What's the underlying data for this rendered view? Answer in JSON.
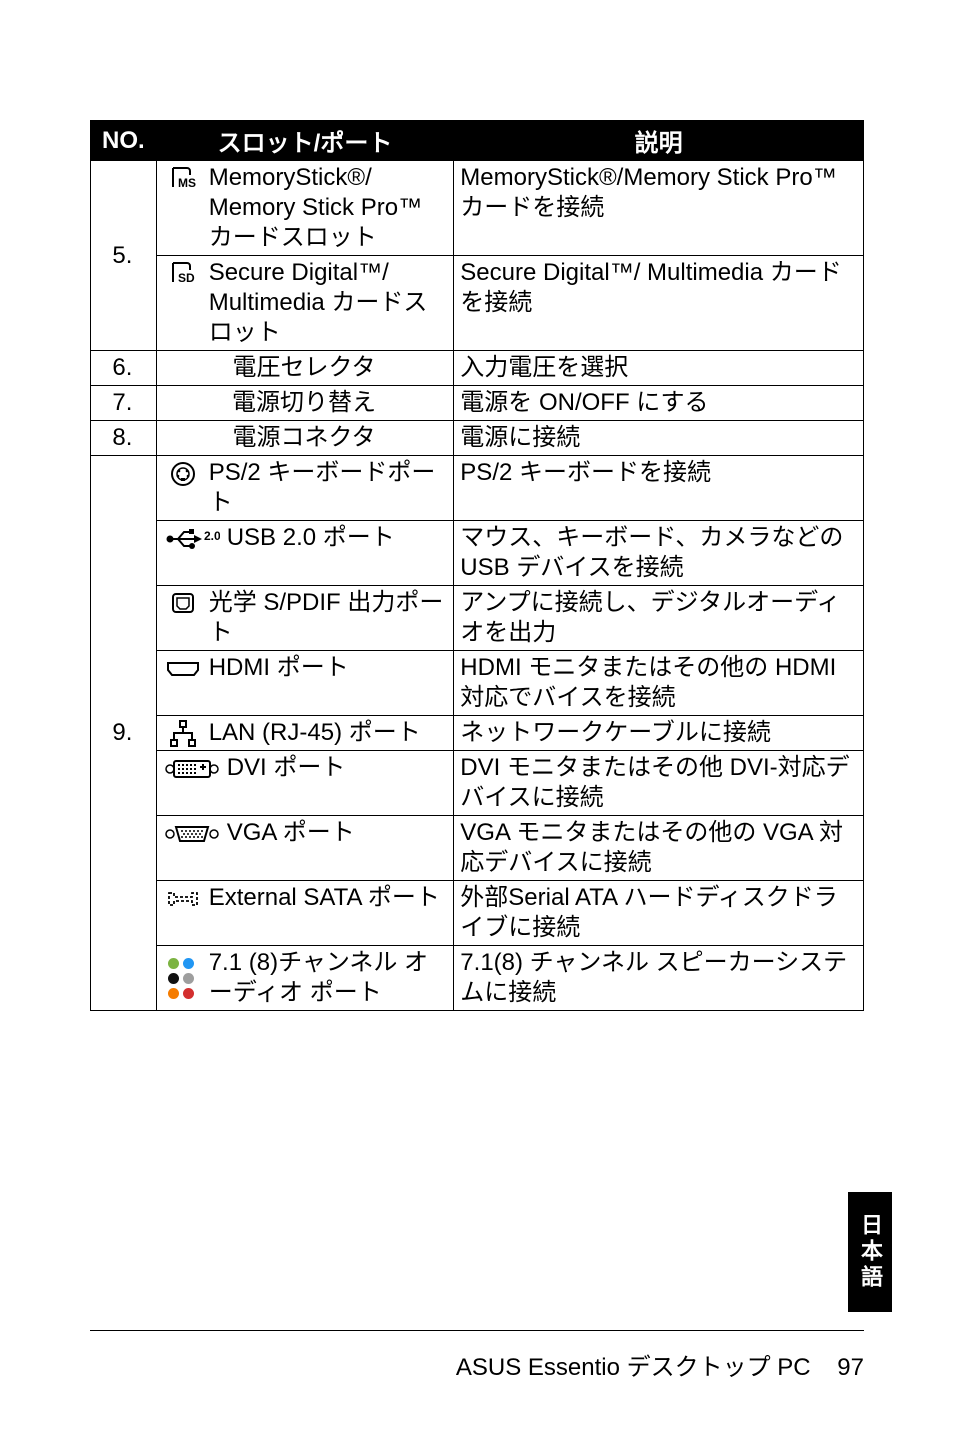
{
  "header": {
    "no": "NO.",
    "slot": "スロット/ポート",
    "desc": "説明"
  },
  "row5": {
    "no": "5.",
    "a_slot": "MemoryStick®/ Memory Stick Pro™ カードスロット",
    "a_desc": "MemoryStick®/Memory Stick Pro™ カードを接続",
    "b_slot": "Secure Digital™/ Multimedia カードスロット",
    "b_desc": "Secure Digital™/ Multimedia カードを接続"
  },
  "row6": {
    "no": "6.",
    "slot": "電圧セレクタ",
    "desc": "入力電圧を選択"
  },
  "row7": {
    "no": "7.",
    "slot": "電源切り替え",
    "desc": "電源を ON/OFF にする"
  },
  "row8": {
    "no": "8.",
    "slot": "電源コネクタ",
    "desc": "電源に接続"
  },
  "row9": {
    "no": "9.",
    "ps2_slot": "PS/2 キーボードポート",
    "ps2_desc": "PS/2 キーボードを接続",
    "usb_icon": "2.0",
    "usb_slot": "USB 2.0 ポート",
    "usb_desc": "マウス、キーボード、カメラなどの USB デバイスを接続",
    "spdif_slot": "光学 S/PDIF 出力ポート",
    "spdif_desc": "アンプに接続し、デジタルオーディオを出力",
    "hdmi_slot": "HDMI ポート",
    "hdmi_desc": "HDMI モニタまたはその他の HDMI 対応でバイスを接続",
    "lan_slot": "LAN (RJ-45) ポート",
    "lan_desc": "ネットワークケーブルに接続",
    "dvi_slot": "DVI ポート",
    "dvi_desc": "DVI モニタまたはその他 DVI-対応デバイスに接続",
    "vga_slot": "VGA ポート",
    "vga_desc": "VGA モニタまたはその他の VGA 対応デバイスに接続",
    "esata_slot": "External SATA ポート",
    "esata_desc": "外部Serial ATA ハードディスクドライブに接続",
    "audio_slot": "7.1 (8)チャンネル オーディオ ポート",
    "audio_desc": "7.1(8) チャンネル スピーカーシステムに接続"
  },
  "tab": "日本語",
  "footer": {
    "title": "ASUS Essentio デスクトップ PC",
    "page": "97"
  },
  "colors": {
    "audio": [
      "#7cb342",
      "#2196f3",
      "#111",
      "#9e9e9e",
      "#f57c00",
      "#d32f2f"
    ]
  }
}
